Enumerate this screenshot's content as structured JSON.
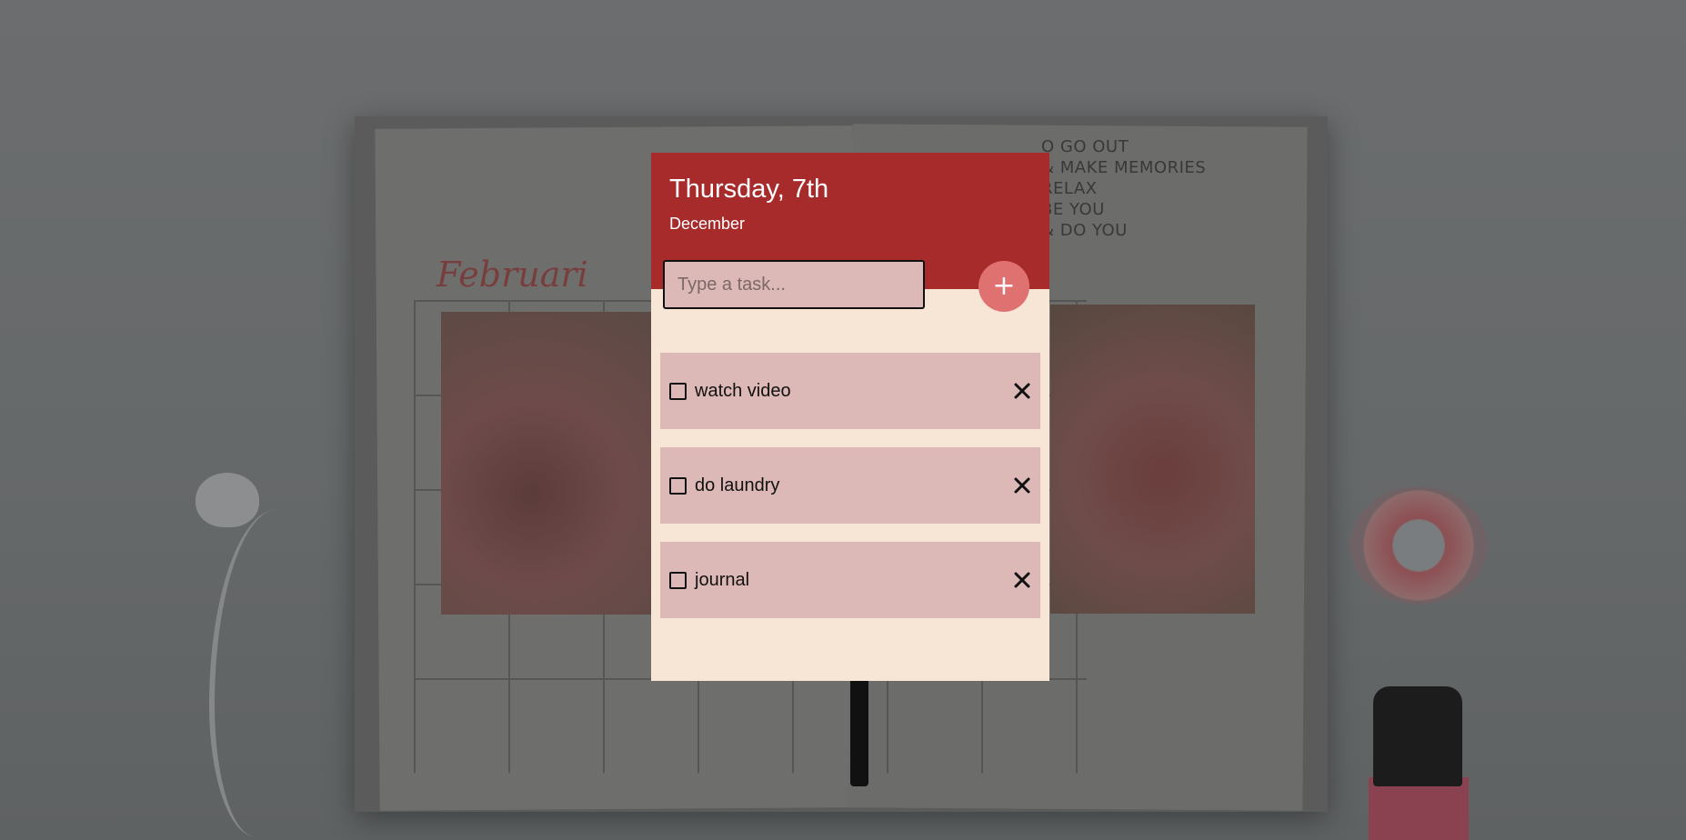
{
  "header": {
    "date_title": "Thursday, 7th",
    "month": "December"
  },
  "input": {
    "placeholder": "Type a task...",
    "value": ""
  },
  "add_button": {
    "label": "+"
  },
  "tasks": [
    {
      "label": "watch video",
      "checked": false
    },
    {
      "label": "do laundry",
      "checked": false
    },
    {
      "label": "journal",
      "checked": false
    }
  ],
  "colors": {
    "header": "#a82b2b",
    "card_bg": "#f7e6d6",
    "task_bg": "#dcb8b6",
    "add_button": "#e07171"
  },
  "icons": {
    "checkbox": "checkbox-empty-icon",
    "delete": "close-icon",
    "add": "plus-icon"
  },
  "background": {
    "journal_heading": "Februari",
    "notes": "O GO OUT\n& MAKE MEMORIES\nRELAX\nBE YOU\n& DO YOU"
  }
}
